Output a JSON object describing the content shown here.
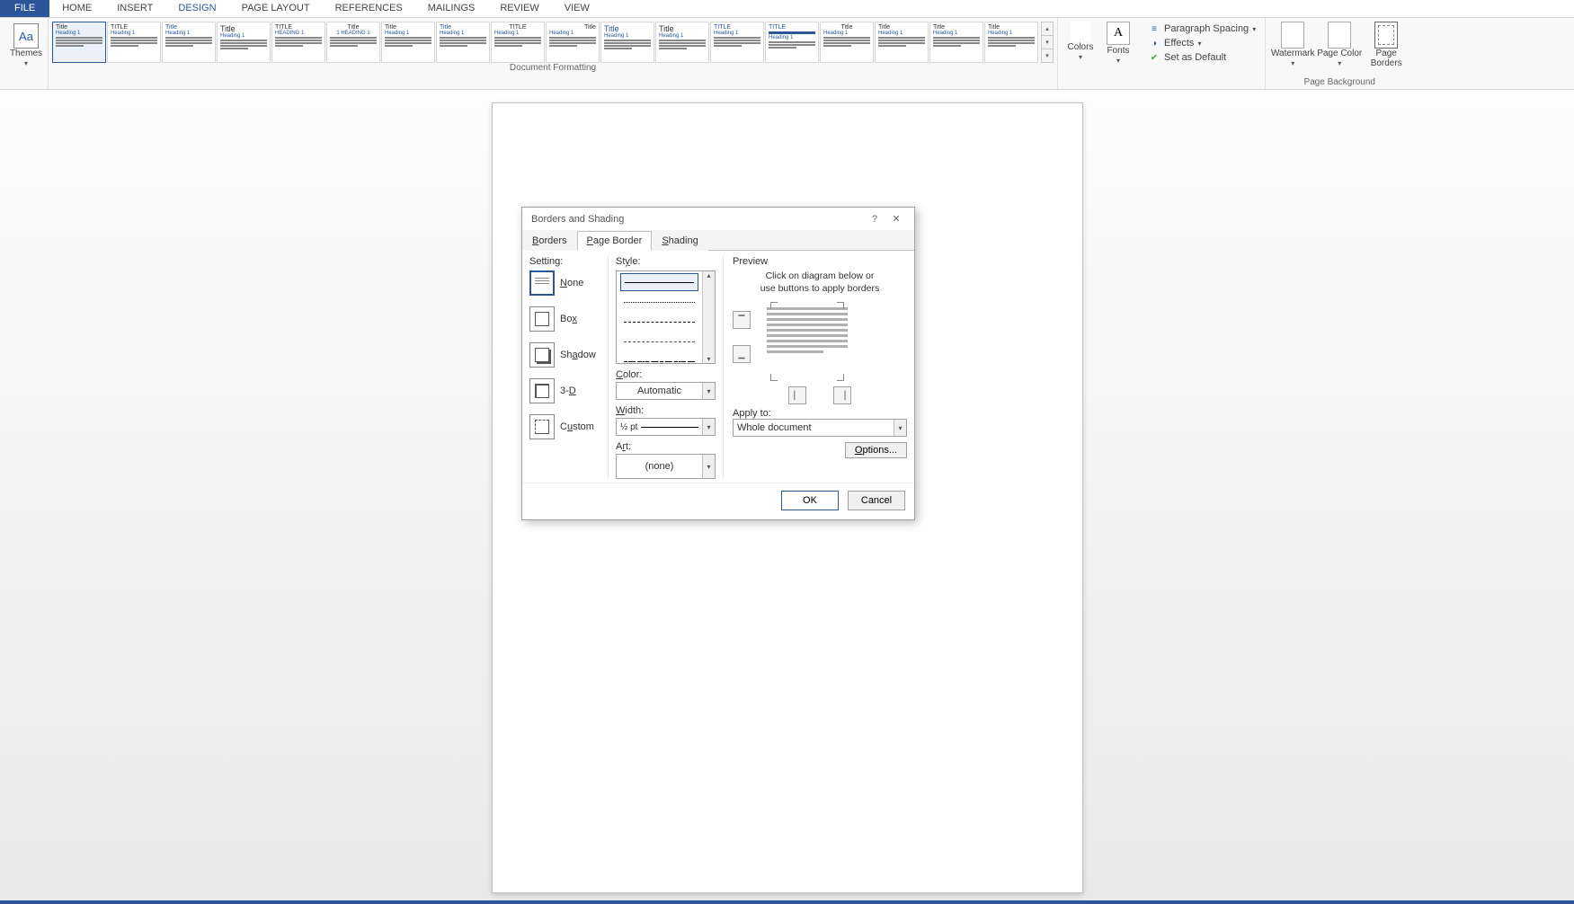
{
  "ribbon": {
    "tabs": [
      "FILE",
      "HOME",
      "INSERT",
      "DESIGN",
      "PAGE LAYOUT",
      "REFERENCES",
      "MAILINGS",
      "REVIEW",
      "VIEW"
    ],
    "active_tab": "DESIGN",
    "themes_label": "Themes",
    "docfmt_label": "Document Formatting",
    "colors_label": "Colors",
    "fonts_label": "Fonts",
    "para_spacing": "Paragraph Spacing",
    "effects": "Effects",
    "set_default": "Set as Default",
    "watermark": "Watermark",
    "page_color": "Page Color",
    "page_borders": "Page Borders",
    "page_bg_label": "Page Background",
    "style_cards": [
      {
        "title": "Title",
        "heading": "Heading 1"
      },
      {
        "title": "TITLE",
        "heading": "Heading 1"
      },
      {
        "title": "Title",
        "heading": "Heading 1"
      },
      {
        "title": "Title",
        "heading": "Heading 1"
      },
      {
        "title": "TITLE",
        "heading": "HEADING 1"
      },
      {
        "title": "Title",
        "heading": "1 HEADING 1"
      },
      {
        "title": "Title",
        "heading": "Heading 1"
      },
      {
        "title": "Title",
        "heading": "Heading 1"
      },
      {
        "title": "TITLE",
        "heading": "Heading 1"
      },
      {
        "title": "Title",
        "heading": "Heading 1"
      },
      {
        "title": "Title",
        "heading": "Heading 1"
      },
      {
        "title": "Title",
        "heading": "Heading 1"
      },
      {
        "title": "TITLE",
        "heading": "Heading 1"
      },
      {
        "title": "TITLE",
        "heading": "Heading 1"
      },
      {
        "title": "Title",
        "heading": "Heading 1"
      },
      {
        "title": "Title",
        "heading": "Heading 1"
      },
      {
        "title": "Title",
        "heading": "Heading 1"
      },
      {
        "title": "Title",
        "heading": "Heading 1"
      }
    ]
  },
  "dialog": {
    "title": "Borders and Shading",
    "tabs": {
      "borders": "Borders",
      "page_border": "Page Border",
      "shading": "Shading"
    },
    "setting_label": "Setting:",
    "settings": {
      "none": "None",
      "box": "Box",
      "shadow": "Shadow",
      "threeD": "3-D",
      "custom": "Custom"
    },
    "style_label": "Style:",
    "color_label": "Color:",
    "color_value": "Automatic",
    "width_label": "Width:",
    "width_value": "½ pt",
    "art_label": "Art:",
    "art_value": "(none)",
    "preview_label": "Preview",
    "preview_hint1": "Click on diagram below or",
    "preview_hint2": "use buttons to apply borders",
    "apply_label": "Apply to:",
    "apply_value": "Whole document",
    "options_btn": "Options...",
    "ok": "OK",
    "cancel": "Cancel"
  }
}
